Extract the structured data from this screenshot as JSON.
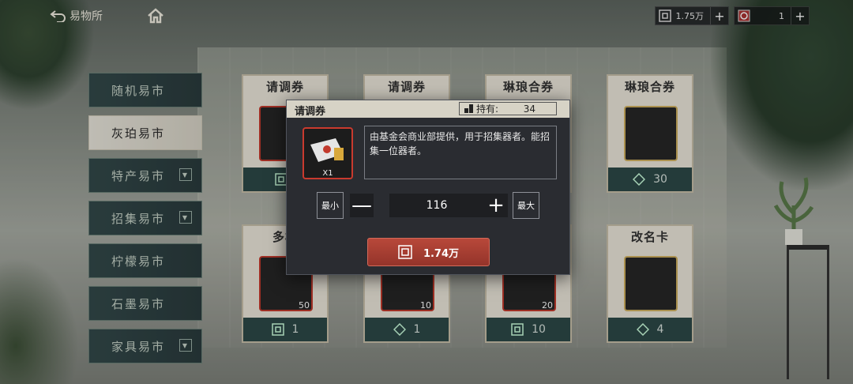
{
  "topbar": {
    "back_label": "易物所",
    "currency": [
      {
        "icon": "coin-icon",
        "value": "1.75万"
      },
      {
        "icon": "token-icon",
        "value": "1"
      }
    ],
    "plus": "+"
  },
  "menu": {
    "items": [
      {
        "label": "随机易市",
        "dropdown": false,
        "active": false
      },
      {
        "label": "灰珀易市",
        "dropdown": false,
        "active": true
      },
      {
        "label": "特产易市",
        "dropdown": true,
        "active": false
      },
      {
        "label": "招集易市",
        "dropdown": true,
        "active": false
      },
      {
        "label": "柠檬易市",
        "dropdown": false,
        "active": false
      },
      {
        "label": "石墨易市",
        "dropdown": false,
        "active": false
      },
      {
        "label": "家具易市",
        "dropdown": true,
        "active": false
      }
    ]
  },
  "cards": [
    {
      "title": "请调券",
      "count": "",
      "price": "",
      "price_icon": "coin-icon"
    },
    {
      "title": "请调券",
      "count": "",
      "price": "",
      "price_icon": "coin-icon"
    },
    {
      "title": "琳琅合券",
      "count": "",
      "price": "",
      "price_icon": "coin-icon"
    },
    {
      "title": "琳琅合券",
      "count": "",
      "price": "30",
      "price_icon": "token-icon"
    },
    {
      "title": "多棱",
      "count": "50",
      "price": "1",
      "price_icon": "coin-icon"
    },
    {
      "title": "",
      "count": "10",
      "price": "1",
      "price_icon": "token-icon"
    },
    {
      "title": "",
      "count": "20",
      "price": "10",
      "price_icon": "coin-icon"
    },
    {
      "title": "改名卡",
      "count": "",
      "price": "4",
      "price_icon": "token-icon"
    }
  ],
  "popup": {
    "title": "请调券",
    "hold_label": "持有:",
    "hold_value": "34",
    "item_count": "X1",
    "description": "由基金会商业部提供，用于招集器者。能招集一位器者。",
    "min_label": "最小",
    "max_label": "最大",
    "minus": "—",
    "plus": "+",
    "quantity": "116",
    "buy_price": "1.74万"
  },
  "colors": {
    "accent_red": "#b8483a",
    "menu_teal": "#2a3b3d",
    "card_cream": "#ece7db",
    "popup_bg": "#2a2c31"
  }
}
